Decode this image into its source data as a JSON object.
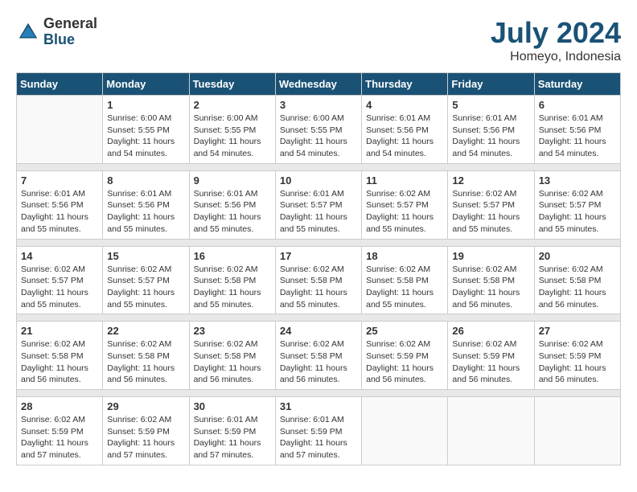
{
  "logo": {
    "general": "General",
    "blue": "Blue"
  },
  "title": {
    "month_year": "July 2024",
    "location": "Homeyo, Indonesia"
  },
  "days_of_week": [
    "Sunday",
    "Monday",
    "Tuesday",
    "Wednesday",
    "Thursday",
    "Friday",
    "Saturday"
  ],
  "weeks": [
    [
      {
        "day": "",
        "empty": true
      },
      {
        "day": "1",
        "sunrise": "Sunrise: 6:00 AM",
        "sunset": "Sunset: 5:55 PM",
        "daylight": "Daylight: 11 hours and 54 minutes."
      },
      {
        "day": "2",
        "sunrise": "Sunrise: 6:00 AM",
        "sunset": "Sunset: 5:55 PM",
        "daylight": "Daylight: 11 hours and 54 minutes."
      },
      {
        "day": "3",
        "sunrise": "Sunrise: 6:00 AM",
        "sunset": "Sunset: 5:55 PM",
        "daylight": "Daylight: 11 hours and 54 minutes."
      },
      {
        "day": "4",
        "sunrise": "Sunrise: 6:01 AM",
        "sunset": "Sunset: 5:56 PM",
        "daylight": "Daylight: 11 hours and 54 minutes."
      },
      {
        "day": "5",
        "sunrise": "Sunrise: 6:01 AM",
        "sunset": "Sunset: 5:56 PM",
        "daylight": "Daylight: 11 hours and 54 minutes."
      },
      {
        "day": "6",
        "sunrise": "Sunrise: 6:01 AM",
        "sunset": "Sunset: 5:56 PM",
        "daylight": "Daylight: 11 hours and 54 minutes."
      }
    ],
    [
      {
        "day": "7",
        "sunrise": "Sunrise: 6:01 AM",
        "sunset": "Sunset: 5:56 PM",
        "daylight": "Daylight: 11 hours and 55 minutes."
      },
      {
        "day": "8",
        "sunrise": "Sunrise: 6:01 AM",
        "sunset": "Sunset: 5:56 PM",
        "daylight": "Daylight: 11 hours and 55 minutes."
      },
      {
        "day": "9",
        "sunrise": "Sunrise: 6:01 AM",
        "sunset": "Sunset: 5:56 PM",
        "daylight": "Daylight: 11 hours and 55 minutes."
      },
      {
        "day": "10",
        "sunrise": "Sunrise: 6:01 AM",
        "sunset": "Sunset: 5:57 PM",
        "daylight": "Daylight: 11 hours and 55 minutes."
      },
      {
        "day": "11",
        "sunrise": "Sunrise: 6:02 AM",
        "sunset": "Sunset: 5:57 PM",
        "daylight": "Daylight: 11 hours and 55 minutes."
      },
      {
        "day": "12",
        "sunrise": "Sunrise: 6:02 AM",
        "sunset": "Sunset: 5:57 PM",
        "daylight": "Daylight: 11 hours and 55 minutes."
      },
      {
        "day": "13",
        "sunrise": "Sunrise: 6:02 AM",
        "sunset": "Sunset: 5:57 PM",
        "daylight": "Daylight: 11 hours and 55 minutes."
      }
    ],
    [
      {
        "day": "14",
        "sunrise": "Sunrise: 6:02 AM",
        "sunset": "Sunset: 5:57 PM",
        "daylight": "Daylight: 11 hours and 55 minutes."
      },
      {
        "day": "15",
        "sunrise": "Sunrise: 6:02 AM",
        "sunset": "Sunset: 5:57 PM",
        "daylight": "Daylight: 11 hours and 55 minutes."
      },
      {
        "day": "16",
        "sunrise": "Sunrise: 6:02 AM",
        "sunset": "Sunset: 5:58 PM",
        "daylight": "Daylight: 11 hours and 55 minutes."
      },
      {
        "day": "17",
        "sunrise": "Sunrise: 6:02 AM",
        "sunset": "Sunset: 5:58 PM",
        "daylight": "Daylight: 11 hours and 55 minutes."
      },
      {
        "day": "18",
        "sunrise": "Sunrise: 6:02 AM",
        "sunset": "Sunset: 5:58 PM",
        "daylight": "Daylight: 11 hours and 55 minutes."
      },
      {
        "day": "19",
        "sunrise": "Sunrise: 6:02 AM",
        "sunset": "Sunset: 5:58 PM",
        "daylight": "Daylight: 11 hours and 56 minutes."
      },
      {
        "day": "20",
        "sunrise": "Sunrise: 6:02 AM",
        "sunset": "Sunset: 5:58 PM",
        "daylight": "Daylight: 11 hours and 56 minutes."
      }
    ],
    [
      {
        "day": "21",
        "sunrise": "Sunrise: 6:02 AM",
        "sunset": "Sunset: 5:58 PM",
        "daylight": "Daylight: 11 hours and 56 minutes."
      },
      {
        "day": "22",
        "sunrise": "Sunrise: 6:02 AM",
        "sunset": "Sunset: 5:58 PM",
        "daylight": "Daylight: 11 hours and 56 minutes."
      },
      {
        "day": "23",
        "sunrise": "Sunrise: 6:02 AM",
        "sunset": "Sunset: 5:58 PM",
        "daylight": "Daylight: 11 hours and 56 minutes."
      },
      {
        "day": "24",
        "sunrise": "Sunrise: 6:02 AM",
        "sunset": "Sunset: 5:58 PM",
        "daylight": "Daylight: 11 hours and 56 minutes."
      },
      {
        "day": "25",
        "sunrise": "Sunrise: 6:02 AM",
        "sunset": "Sunset: 5:59 PM",
        "daylight": "Daylight: 11 hours and 56 minutes."
      },
      {
        "day": "26",
        "sunrise": "Sunrise: 6:02 AM",
        "sunset": "Sunset: 5:59 PM",
        "daylight": "Daylight: 11 hours and 56 minutes."
      },
      {
        "day": "27",
        "sunrise": "Sunrise: 6:02 AM",
        "sunset": "Sunset: 5:59 PM",
        "daylight": "Daylight: 11 hours and 56 minutes."
      }
    ],
    [
      {
        "day": "28",
        "sunrise": "Sunrise: 6:02 AM",
        "sunset": "Sunset: 5:59 PM",
        "daylight": "Daylight: 11 hours and 57 minutes."
      },
      {
        "day": "29",
        "sunrise": "Sunrise: 6:02 AM",
        "sunset": "Sunset: 5:59 PM",
        "daylight": "Daylight: 11 hours and 57 minutes."
      },
      {
        "day": "30",
        "sunrise": "Sunrise: 6:01 AM",
        "sunset": "Sunset: 5:59 PM",
        "daylight": "Daylight: 11 hours and 57 minutes."
      },
      {
        "day": "31",
        "sunrise": "Sunrise: 6:01 AM",
        "sunset": "Sunset: 5:59 PM",
        "daylight": "Daylight: 11 hours and 57 minutes."
      },
      {
        "day": "",
        "empty": true
      },
      {
        "day": "",
        "empty": true
      },
      {
        "day": "",
        "empty": true
      }
    ]
  ]
}
